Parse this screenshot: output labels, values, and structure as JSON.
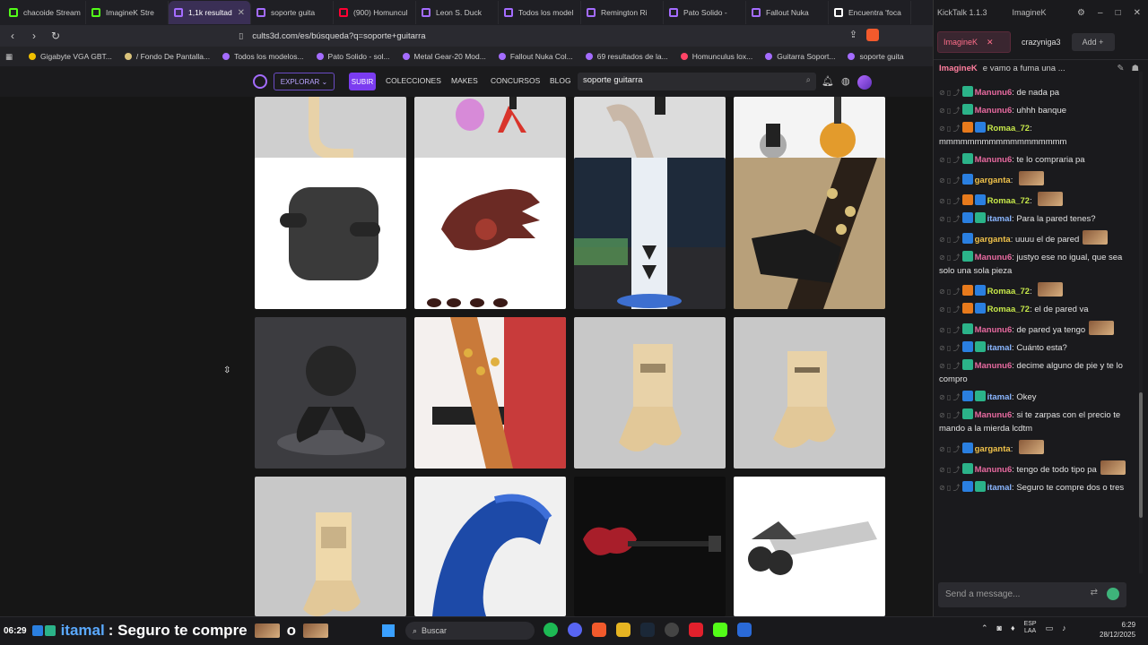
{
  "tabs": [
    {
      "label": "chacoide Stream",
      "color": "#53fc18",
      "active": false
    },
    {
      "label": "ImagineK Stre",
      "color": "#53fc18",
      "active": false
    },
    {
      "label": "1,1k resultad",
      "color": "#a46cff",
      "active": true
    },
    {
      "label": "soporte guita",
      "color": "#a46cff",
      "active": false
    },
    {
      "label": "(900) Homuncul",
      "color": "#ff0033",
      "active": false
    },
    {
      "label": "Leon S. Duck",
      "color": "#a46cff",
      "active": false
    },
    {
      "label": "Todos los model",
      "color": "#a46cff",
      "active": false
    },
    {
      "label": "Remington Ri",
      "color": "#a46cff",
      "active": false
    },
    {
      "label": "Pato Solido -",
      "color": "#a46cff",
      "active": false
    },
    {
      "label": "Fallout Nuka",
      "color": "#a46cff",
      "active": false
    },
    {
      "label": "Encuentra 'foca",
      "color": "#ffffff",
      "active": false
    }
  ],
  "url": "cults3d.com/es/búsqueda?q=soporte+guitarra",
  "bookmarks": [
    {
      "label": "Gigabyte VGA GBT...",
      "color": "#f0c000"
    },
    {
      "label": "/ Fondo De Pantalla...",
      "color": "#d9c27b"
    },
    {
      "label": "Todos los modelos...",
      "color": "#a46cff"
    },
    {
      "label": "Pato Solido - sol...",
      "color": "#a46cff"
    },
    {
      "label": "Metal Gear-20 Mod...",
      "color": "#a46cff"
    },
    {
      "label": "Fallout Nuka Col...",
      "color": "#a46cff"
    },
    {
      "label": "69 resultados de la...",
      "color": "#a46cff"
    },
    {
      "label": "Homunculus lox...",
      "color": "#ff4466"
    },
    {
      "label": "Guitarra Soport...",
      "color": "#a46cff"
    },
    {
      "label": "soporte guita",
      "color": "#a46cff"
    }
  ],
  "site": {
    "explorar": "EXPLORAR",
    "subir": "SUBIR",
    "links": [
      "COLECCIONES",
      "MAKES",
      "CONCURSOS",
      "BLOG"
    ],
    "search_value": "soporte guitarra"
  },
  "chat": {
    "app_title": "KickTalk 1.1.3",
    "title_user": "ImagineK",
    "tab_active": "ImagineK",
    "tab_other": "crazyniga3",
    "add_label": "Add",
    "stream_user": "ImagineK",
    "stream_title": "e vamo a fuma una ...",
    "input_placeholder": "Send a message...",
    "messages": [
      {
        "user": "Manunu6",
        "ucls": "u-pink",
        "badges": [
          "b-green"
        ],
        "text": "de nada pa",
        "emote": false
      },
      {
        "user": "Manunu6",
        "ucls": "u-pink",
        "badges": [
          "b-green"
        ],
        "text": "uhhh banque",
        "emote": false
      },
      {
        "user": "Romaa_72",
        "ucls": "u-lime",
        "badges": [
          "b-orange",
          "b-blue"
        ],
        "text": "mmmmmmmmmmmmmmmmmm",
        "emote": false
      },
      {
        "user": "Manunu6",
        "ucls": "u-pink",
        "badges": [
          "b-green"
        ],
        "text": "te lo compraria pa",
        "emote": false
      },
      {
        "user": "garganta",
        "ucls": "u-yellow",
        "badges": [
          "b-blue"
        ],
        "text": "",
        "emote": true
      },
      {
        "user": "Romaa_72",
        "ucls": "u-lime",
        "badges": [
          "b-orange",
          "b-blue"
        ],
        "text": "",
        "emote": true
      },
      {
        "user": "itamal",
        "ucls": "u-blue",
        "badges": [
          "b-blue",
          "b-green"
        ],
        "text": "Para la pared tenes?",
        "emote": false
      },
      {
        "user": "garganta",
        "ucls": "u-yellow",
        "badges": [
          "b-blue"
        ],
        "text": "uuuu el de pared",
        "emote": true
      },
      {
        "user": "Manunu6",
        "ucls": "u-pink",
        "badges": [
          "b-green"
        ],
        "text": "justyo ese no igual, que sea solo una sola pieza",
        "emote": false
      },
      {
        "user": "Romaa_72",
        "ucls": "u-lime",
        "badges": [
          "b-orange",
          "b-blue"
        ],
        "text": "",
        "emote": true
      },
      {
        "user": "Romaa_72",
        "ucls": "u-lime",
        "badges": [
          "b-orange",
          "b-blue"
        ],
        "text": "el de pared va",
        "emote": false
      },
      {
        "user": "Manunu6",
        "ucls": "u-pink",
        "badges": [
          "b-green"
        ],
        "text": "de pared ya tengo",
        "emote": true
      },
      {
        "user": "itamal",
        "ucls": "u-blue",
        "badges": [
          "b-blue",
          "b-green"
        ],
        "text": "Cuánto esta?",
        "emote": false
      },
      {
        "user": "Manunu6",
        "ucls": "u-pink",
        "badges": [
          "b-green"
        ],
        "text": "decime alguno de pie y te lo compro",
        "emote": false
      },
      {
        "user": "itamal",
        "ucls": "u-blue",
        "badges": [
          "b-blue",
          "b-green"
        ],
        "text": "Okey",
        "emote": false
      },
      {
        "user": "Manunu6",
        "ucls": "u-pink",
        "badges": [
          "b-green"
        ],
        "text": "si te zarpas con el precio te mando a la mierda lcdtm",
        "emote": false
      },
      {
        "user": "garganta",
        "ucls": "u-yellow",
        "badges": [
          "b-blue"
        ],
        "text": "",
        "emote": true
      },
      {
        "user": "Manunu6",
        "ucls": "u-pink",
        "badges": [
          "b-green"
        ],
        "text": "tengo de todo tipo pa",
        "emote": true
      },
      {
        "user": "itamal",
        "ucls": "u-blue",
        "badges": [
          "b-blue",
          "b-green"
        ],
        "text": "Seguro te compre dos o tres",
        "emote": false
      }
    ]
  },
  "taskbar": {
    "overlay_time": "06:29",
    "overlay_user": "itamal",
    "overlay_text": ": Seguro te compre",
    "overlay_o": "o",
    "search_label": "Buscar",
    "lang": "ESP",
    "lang2": "LAA",
    "time": "6:29",
    "date": "28/12/2025"
  }
}
